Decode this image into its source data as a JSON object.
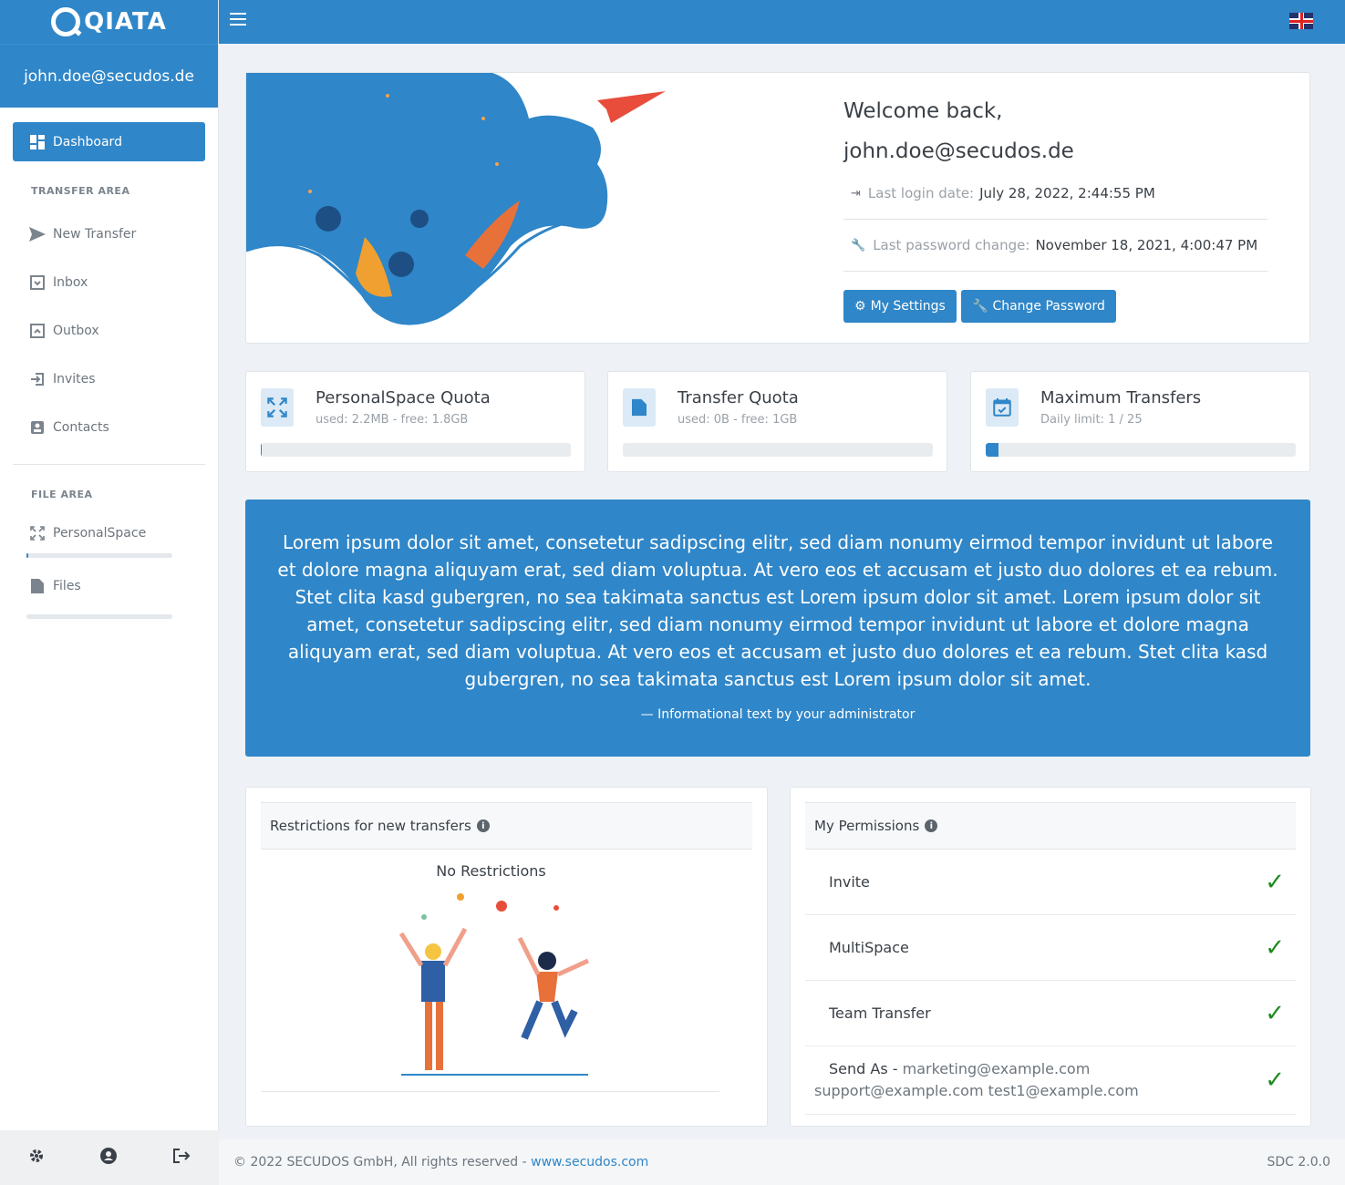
{
  "brand": {
    "name": "QIATA"
  },
  "user": {
    "email": "john.doe@secudos.de"
  },
  "sidebar": {
    "dashboard": "Dashboard",
    "transfer_area_title": "TRANSFER AREA",
    "transfer_items": [
      {
        "label": "New Transfer",
        "icon": "send-icon"
      },
      {
        "label": "Inbox",
        "icon": "inbox-icon"
      },
      {
        "label": "Outbox",
        "icon": "outbox-icon"
      },
      {
        "label": "Invites",
        "icon": "invite-icon"
      },
      {
        "label": "Contacts",
        "icon": "contacts-icon"
      }
    ],
    "file_area_title": "FILE AREA",
    "file_items": [
      {
        "label": "PersonalSpace",
        "icon": "expand-icon",
        "usage_fraction": 0.01
      },
      {
        "label": "Files",
        "icon": "file-icon",
        "usage_fraction": 0
      }
    ]
  },
  "welcome": {
    "greeting": "Welcome back,",
    "name": "john.doe@secudos.de",
    "last_login_label": "Last login date:",
    "last_login_value": "July 28, 2022, 2:44:55 PM",
    "last_pw_label": "Last password change:",
    "last_pw_value": "November 18, 2021, 4:00:47 PM",
    "settings_button": "My Settings",
    "password_button": "Change Password"
  },
  "quotas": [
    {
      "title": "PersonalSpace Quota",
      "subtitle": "used: 2.2MB - free: 1.8GB",
      "fraction": 0.003,
      "icon": "expand-icon"
    },
    {
      "title": "Transfer Quota",
      "subtitle": "used: 0B - free: 1GB",
      "fraction": 0,
      "icon": "file-icon"
    },
    {
      "title": "Maximum Transfers",
      "subtitle": "Daily limit: 1 / 25",
      "fraction": 0.04,
      "icon": "calendar-check-icon"
    }
  ],
  "admin_message": {
    "text": "Lorem ipsum dolor sit amet, consetetur sadipscing elitr, sed diam nonumy eirmod tempor invidunt ut labore et dolore magna aliquyam erat, sed diam voluptua. At vero eos et accusam et justo duo dolores et ea rebum. Stet clita kasd gubergren, no sea takimata sanctus est Lorem ipsum dolor sit amet. Lorem ipsum dolor sit amet, consetetur sadipscing elitr, sed diam nonumy eirmod tempor invidunt ut labore et dolore magna aliquyam erat, sed diam voluptua. At vero eos et accusam et justo duo dolores et ea rebum. Stet clita kasd gubergren, no sea takimata sanctus est Lorem ipsum dolor sit amet.",
    "attribution": "— Informational text by your administrator"
  },
  "restrictions": {
    "title": "Restrictions for new transfers",
    "status": "No Restrictions"
  },
  "permissions": {
    "title": "My Permissions",
    "items": [
      {
        "label": "Invite",
        "granted": true
      },
      {
        "label": "MultiSpace",
        "granted": true
      },
      {
        "label": "Team Transfer",
        "granted": true
      }
    ],
    "send_as_label": "Send As -",
    "send_as_first": "marketing@example.com",
    "send_as_rest": "support@example.com test1@example.com"
  },
  "footer": {
    "copyright": "© 2022 SECUDOS GmbH, All rights reserved -",
    "link": "www.secudos.com",
    "version": "SDC 2.0.0"
  },
  "colors": {
    "primary": "#2f86c8",
    "success": "#1e8a1e"
  }
}
